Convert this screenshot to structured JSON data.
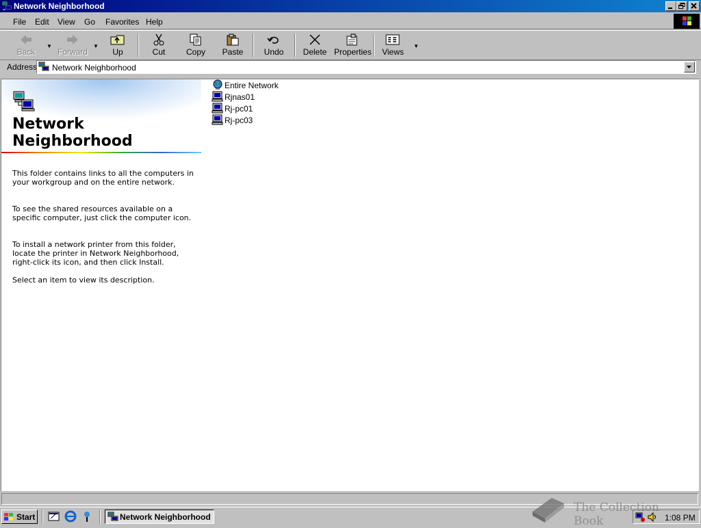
{
  "window": {
    "title": "Network Neighborhood"
  },
  "menu": [
    {
      "key": "F",
      "rest": "ile"
    },
    {
      "key": "E",
      "rest": "dit"
    },
    {
      "key": "V",
      "rest": "iew"
    },
    {
      "key": "G",
      "rest": "o"
    },
    {
      "key": "F",
      "rest": "avorites",
      "prefix": ""
    },
    {
      "key": "H",
      "rest": "elp"
    }
  ],
  "menu_labels": {
    "file": "File",
    "edit": "Edit",
    "view": "View",
    "go": "Go",
    "favorites": "Favorites",
    "help": "Help"
  },
  "toolbar": {
    "back": "Back",
    "forward": "Forward",
    "up": "Up",
    "cut": "Cut",
    "copy": "Copy",
    "paste": "Paste",
    "undo": "Undo",
    "delete": "Delete",
    "properties": "Properties",
    "views": "Views"
  },
  "address": {
    "label": "Address",
    "value": "Network Neighborhood"
  },
  "left_pane": {
    "title_line1": "Network",
    "title_line2": "Neighborhood",
    "p1": "This folder contains links to all the computers in your workgroup and on the entire network.",
    "p2": "To see the shared resources available on a specific computer, just click the computer icon.",
    "p3": "To install a network printer from this folder, locate the printer in Network Neighborhood, right-click its icon, and then click Install.",
    "p4": "Select an item to view its description."
  },
  "items": [
    {
      "label": "Entire Network",
      "icon": "globe-icon"
    },
    {
      "label": "Rjnas01",
      "icon": "computer-icon"
    },
    {
      "label": "Rj-pc01",
      "icon": "computer-icon"
    },
    {
      "label": "Rj-pc03",
      "icon": "computer-icon"
    }
  ],
  "taskbar": {
    "start": "Start",
    "task": "Network Neighborhood",
    "clock": "1:08 PM"
  },
  "watermark": {
    "text": "The Collection Book"
  },
  "colors": {
    "titlebar": "#000080",
    "face": "#c0c0c0",
    "window_bg": "#ffffff"
  }
}
